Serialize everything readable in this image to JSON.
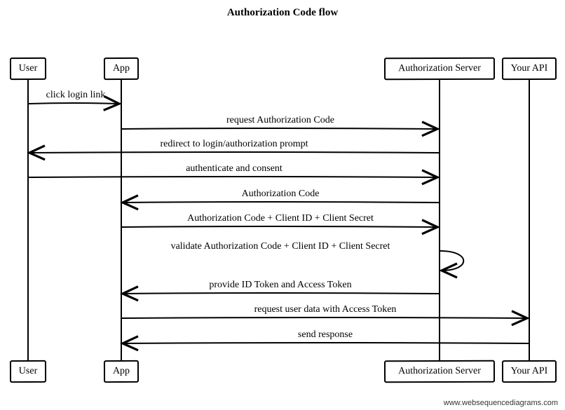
{
  "title": "Authorization Code flow",
  "footer": "www.websequencediagrams.com",
  "actors": {
    "user": "User",
    "app": "App",
    "authserver": "Authorization Server",
    "api": "Your API"
  },
  "messages": {
    "m1": "click login link",
    "m2": "request Authorization Code",
    "m3": "redirect to login/authorization prompt",
    "m4": "authenticate and consent",
    "m5": "Authorization Code",
    "m6": "Authorization Code + Client ID + Client Secret",
    "m7": "validate Authorization Code + Client ID + Client Secret",
    "m8": "provide ID Token and Access Token",
    "m9": "request user data with Access Token",
    "m10": "send response"
  },
  "diagram_spec": {
    "type": "sequence",
    "participants": [
      "User",
      "App",
      "Authorization Server",
      "Your API"
    ],
    "steps": [
      {
        "from": "User",
        "to": "App",
        "label": "click login link"
      },
      {
        "from": "App",
        "to": "Authorization Server",
        "label": "request Authorization Code"
      },
      {
        "from": "Authorization Server",
        "to": "User",
        "label": "redirect to login/authorization prompt"
      },
      {
        "from": "User",
        "to": "Authorization Server",
        "label": "authenticate and consent"
      },
      {
        "from": "Authorization Server",
        "to": "App",
        "label": "Authorization Code"
      },
      {
        "from": "App",
        "to": "Authorization Server",
        "label": "Authorization Code + Client ID + Client Secret"
      },
      {
        "from": "Authorization Server",
        "to": "Authorization Server",
        "label": "validate Authorization Code + Client ID + Client Secret"
      },
      {
        "from": "Authorization Server",
        "to": "App",
        "label": "provide ID Token and Access Token"
      },
      {
        "from": "App",
        "to": "Your API",
        "label": "request user data with Access Token"
      },
      {
        "from": "Your API",
        "to": "App",
        "label": "send response"
      }
    ]
  }
}
